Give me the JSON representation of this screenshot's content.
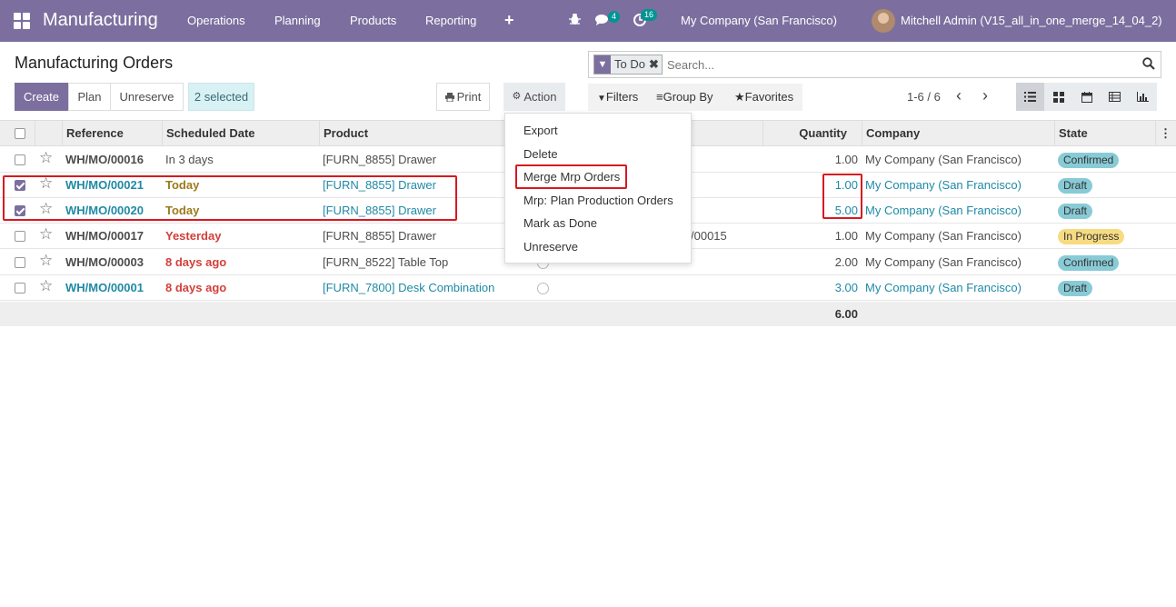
{
  "navbar": {
    "app_name": "Manufacturing",
    "menus": [
      "Operations",
      "Planning",
      "Products",
      "Reporting"
    ],
    "chat_count": "4",
    "activity_count": "16",
    "company": "My Company (San Francisco)",
    "user": "Mitchell Admin (V15_all_in_one_merge_14_04_2)"
  },
  "page": {
    "title": "Manufacturing Orders",
    "create_label": "Create",
    "plan_label": "Plan",
    "unreserve_label": "Unreserve",
    "selected_label": "2 selected",
    "print_label": "Print",
    "action_label": "Action"
  },
  "search": {
    "facet": "To Do",
    "placeholder": "Search..."
  },
  "filters": {
    "filters_label": "Filters",
    "groupby_label": "Group By",
    "favorites_label": "Favorites"
  },
  "pager": {
    "value": "1-6 / 6"
  },
  "table": {
    "headers": {
      "reference": "Reference",
      "scheduled": "Scheduled Date",
      "product": "Product",
      "quantity": "Quantity",
      "company": "Company",
      "state": "State"
    },
    "rows": [
      {
        "checked": false,
        "reference": "WH/MO/00016",
        "date": "In 3 days",
        "product": "[FURN_8855] Drawer",
        "source": "",
        "qty": "1.00",
        "company": "My Company (San Francisco)",
        "state": "Confirmed"
      },
      {
        "checked": true,
        "reference": "WH/MO/00021",
        "date": "Today",
        "product": "[FURN_8855] Drawer",
        "source": "",
        "qty": "1.00",
        "company": "My Company (San Francisco)",
        "state": "Draft"
      },
      {
        "checked": true,
        "reference": "WH/MO/00020",
        "date": "Today",
        "product": "[FURN_8855] Drawer",
        "source": "",
        "qty": "5.00",
        "company": "My Company (San Francisco)",
        "state": "Draft"
      },
      {
        "checked": false,
        "reference": "WH/MO/00017",
        "date": "Yesterday",
        "product": "[FURN_8855] Drawer",
        "source": "/00015",
        "qty": "1.00",
        "company": "My Company (San Francisco)",
        "state": "In Progress"
      },
      {
        "checked": false,
        "reference": "WH/MO/00003",
        "date": "8 days ago",
        "product": "[FURN_8522] Table Top",
        "source": "",
        "qty": "2.00",
        "company": "My Company (San Francisco)",
        "state": "Confirmed"
      },
      {
        "checked": false,
        "reference": "WH/MO/00001",
        "date": "8 days ago",
        "product": "[FURN_7800] Desk Combination",
        "source": "",
        "qty": "3.00",
        "company": "My Company (San Francisco)",
        "state": "Draft"
      }
    ],
    "total_qty": "6.00"
  },
  "action_menu": {
    "items": [
      "Export",
      "Delete",
      "Merge Mrp Orders",
      "Mrp: Plan Production Orders",
      "Mark as Done",
      "Unreserve"
    ]
  }
}
